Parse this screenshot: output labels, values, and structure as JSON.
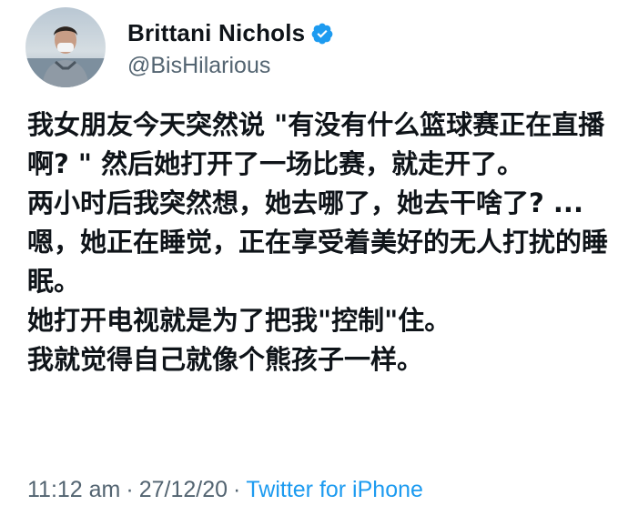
{
  "tweet": {
    "author": {
      "display_name": "Brittani Nichols",
      "handle": "@BisHilarious",
      "verified": true,
      "avatar_icon": "profile-photo"
    },
    "text": "我女朋友今天突然说 \"有没有什么篮球赛正在直播啊? \" 然后她打开了一场比赛，就走开了。\n两小时后我突然想，她去哪了，她去干啥了? ...嗯，她正在睡觉，正在享受着美好的无人打扰的睡眠。\n她打开电视就是为了把我\"控制\"住。\n我就觉得自己就像个熊孩子一样。",
    "footer": {
      "time": "11:12 am",
      "separator_1": "·",
      "date": "27/12/20",
      "separator_2": "·",
      "source": "Twitter for iPhone"
    }
  },
  "colors": {
    "text_primary": "#0f1419",
    "text_secondary": "#536471",
    "accent": "#1d9bf0"
  }
}
